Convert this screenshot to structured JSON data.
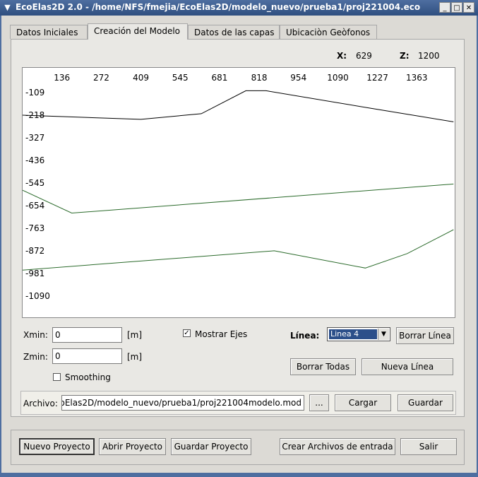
{
  "window": {
    "title": "EcoElas2D 2.0 - /home/NFS/fmejia/EcoElas2D/modelo_nuevo/prueba1/proj221004.eco"
  },
  "tabs": [
    {
      "label": "Datos Iniciales"
    },
    {
      "label": "Creación del Modelo"
    },
    {
      "label": "Datos de las capas"
    },
    {
      "label": "Ubicaciòn Geòfonos"
    }
  ],
  "coords": {
    "x_label": "X:",
    "x_value": "629",
    "z_label": "Z:",
    "z_value": "1200"
  },
  "plot": {
    "x_ticks": [
      "136",
      "272",
      "409",
      "545",
      "681",
      "818",
      "954",
      "1090",
      "1227",
      "1363"
    ],
    "y_ticks": [
      "-109",
      "-218",
      "-327",
      "-436",
      "-545",
      "-654",
      "-763",
      "-872",
      "-981",
      "-1090"
    ],
    "lines": [
      {
        "color": "#000000",
        "points": [
          [
            0,
            218
          ],
          [
            409,
            238
          ],
          [
            618,
            211
          ],
          [
            772,
            100
          ],
          [
            842,
            100
          ],
          [
            1227,
            190
          ],
          [
            1490,
            250
          ]
        ]
      },
      {
        "color": "#2a6a2a",
        "points": [
          [
            0,
            580
          ],
          [
            170,
            690
          ],
          [
            1490,
            550
          ]
        ]
      },
      {
        "color": "#2a6a2a",
        "points": [
          [
            0,
            965
          ],
          [
            870,
            872
          ],
          [
            1185,
            955
          ],
          [
            1330,
            885
          ],
          [
            1490,
            770
          ]
        ]
      }
    ]
  },
  "controls": {
    "xmin_label": "Xmin:",
    "xmin_value": "0",
    "xmin_unit": "[m]",
    "zmin_label": "Zmin:",
    "zmin_value": "0",
    "zmin_unit": "[m]",
    "smoothing_label": "Smoothing",
    "mostrar_ejes_label": "Mostrar Ejes",
    "linea_label": "Línea:",
    "linea_value": "Linea 4",
    "borrar_linea": "Borrar Línea",
    "borrar_todas": "Borrar Todas",
    "nueva_linea": "Nueva Línea"
  },
  "file": {
    "label": "Archivo:",
    "value": "EcoElas2D/modelo_nuevo/prueba1/proj221004modelo.mod",
    "browse": "...",
    "cargar": "Cargar",
    "guardar": "Guardar"
  },
  "bottom": {
    "nuevo_proyecto": "Nuevo Proyecto",
    "abrir_proyecto": "Abrir Proyecto",
    "guardar_proyecto": "Guardar Proyecto",
    "crear_archivos": "Crear Archivos de entrada",
    "salir": "Salir"
  }
}
